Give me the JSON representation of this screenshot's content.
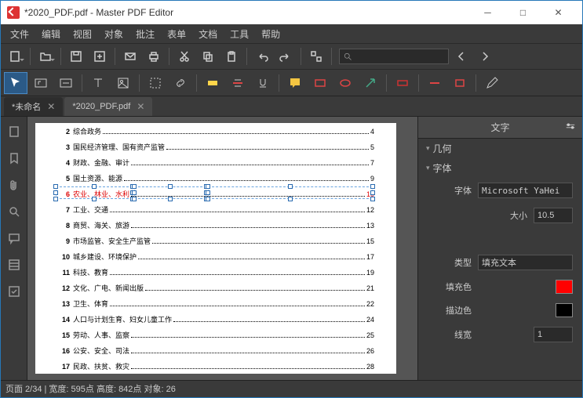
{
  "window": {
    "title": "*2020_PDF.pdf - Master PDF Editor"
  },
  "menu": [
    "文件",
    "编辑",
    "视图",
    "对象",
    "批注",
    "表单",
    "文档",
    "工具",
    "帮助"
  ],
  "tabs": [
    {
      "label": "*未命名",
      "active": false
    },
    {
      "label": "*2020_PDF.pdf",
      "active": true
    }
  ],
  "toc": [
    {
      "n": "2",
      "t": "综合政务",
      "p": "4"
    },
    {
      "n": "3",
      "t": "国民经济管理、国有资产监管",
      "p": "5"
    },
    {
      "n": "4",
      "t": "财政、金融、审计",
      "p": "7"
    },
    {
      "n": "5",
      "t": "国土资源、能源",
      "p": "9"
    },
    {
      "n": "6",
      "t": "农业、林业、水利",
      "p": "10",
      "selected": true
    },
    {
      "n": "7",
      "t": "工业、交通",
      "p": "12"
    },
    {
      "n": "8",
      "t": "商贸、海关、旅游",
      "p": "13"
    },
    {
      "n": "9",
      "t": "市场监管、安全生产监管",
      "p": "15"
    },
    {
      "n": "10",
      "t": "城乡建设、环境保护",
      "p": "17"
    },
    {
      "n": "11",
      "t": "科技、教育",
      "p": "19"
    },
    {
      "n": "12",
      "t": "文化、广电、新闻出版",
      "p": "21"
    },
    {
      "n": "13",
      "t": "卫生、体育",
      "p": "22"
    },
    {
      "n": "14",
      "t": "人口与计划生育、妇女儿童工作",
      "p": "24"
    },
    {
      "n": "15",
      "t": "劳动、人事、监察",
      "p": "25"
    },
    {
      "n": "16",
      "t": "公安、安全、司法",
      "p": "26"
    },
    {
      "n": "17",
      "t": "民政、扶贫、救灾",
      "p": "28"
    }
  ],
  "props": {
    "header": "文字",
    "sec_geom": "几何",
    "sec_font": "字体",
    "font_label": "字体",
    "font_value": "Microsoft YaHei",
    "size_label": "大小",
    "size_value": "10.5",
    "type_label": "类型",
    "type_value": "填充文本",
    "fill_label": "填充色",
    "fill_color": "#ff0000",
    "stroke_label": "描边色",
    "stroke_color": "#000000",
    "lw_label": "线宽",
    "lw_value": "1"
  },
  "status": "页面 2/34 | 宽度: 595点 高度: 842点 对象: 26"
}
